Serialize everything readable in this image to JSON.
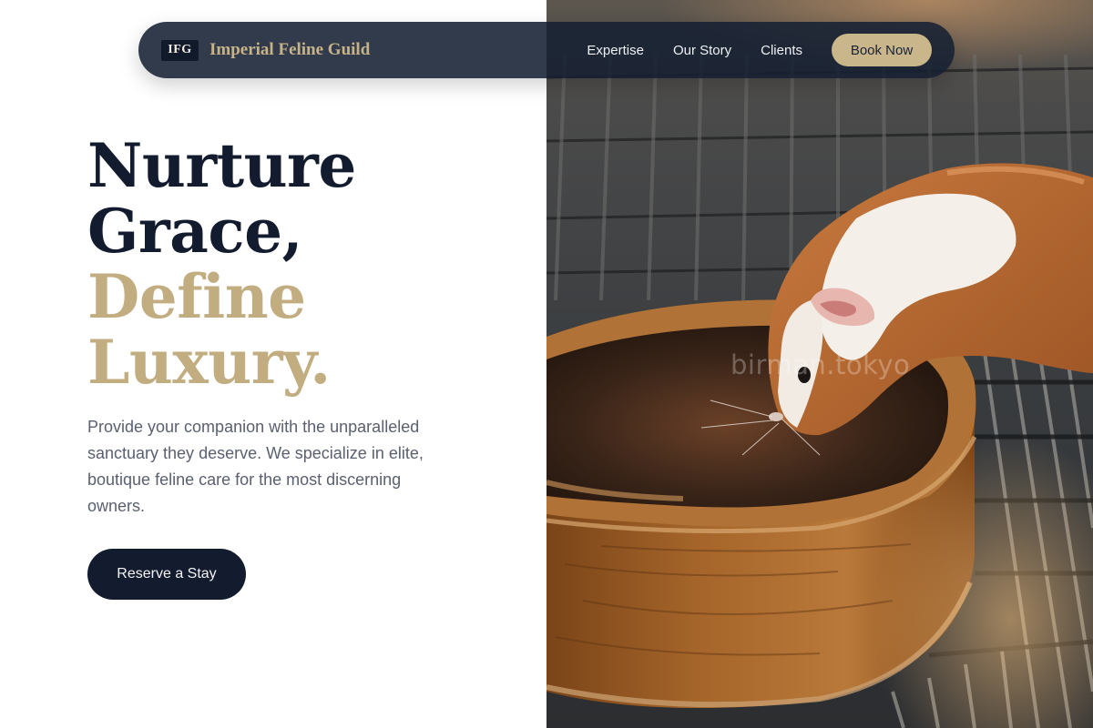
{
  "brand": {
    "badge": "IFG",
    "name": "Imperial Feline Guild"
  },
  "nav": {
    "links": [
      "Expertise",
      "Our Story",
      "Clients"
    ],
    "book_label": "Book Now"
  },
  "hero": {
    "headline_dark": [
      "Nurture",
      "Grace,"
    ],
    "headline_gold": [
      "Define",
      "Luxury."
    ],
    "intro": "Provide your companion with the unparalleled sanctuary they deserve. We specialize in elite, boutique feline care for the most discerning owners.",
    "cta_label": "Reserve a Stay"
  },
  "photo": {
    "watermark": "birman.tokyo"
  },
  "colors": {
    "navy": "#131b2e",
    "gold": "#c2ad80",
    "button_gold": "#c9b68b",
    "body_text": "#5a6070"
  }
}
